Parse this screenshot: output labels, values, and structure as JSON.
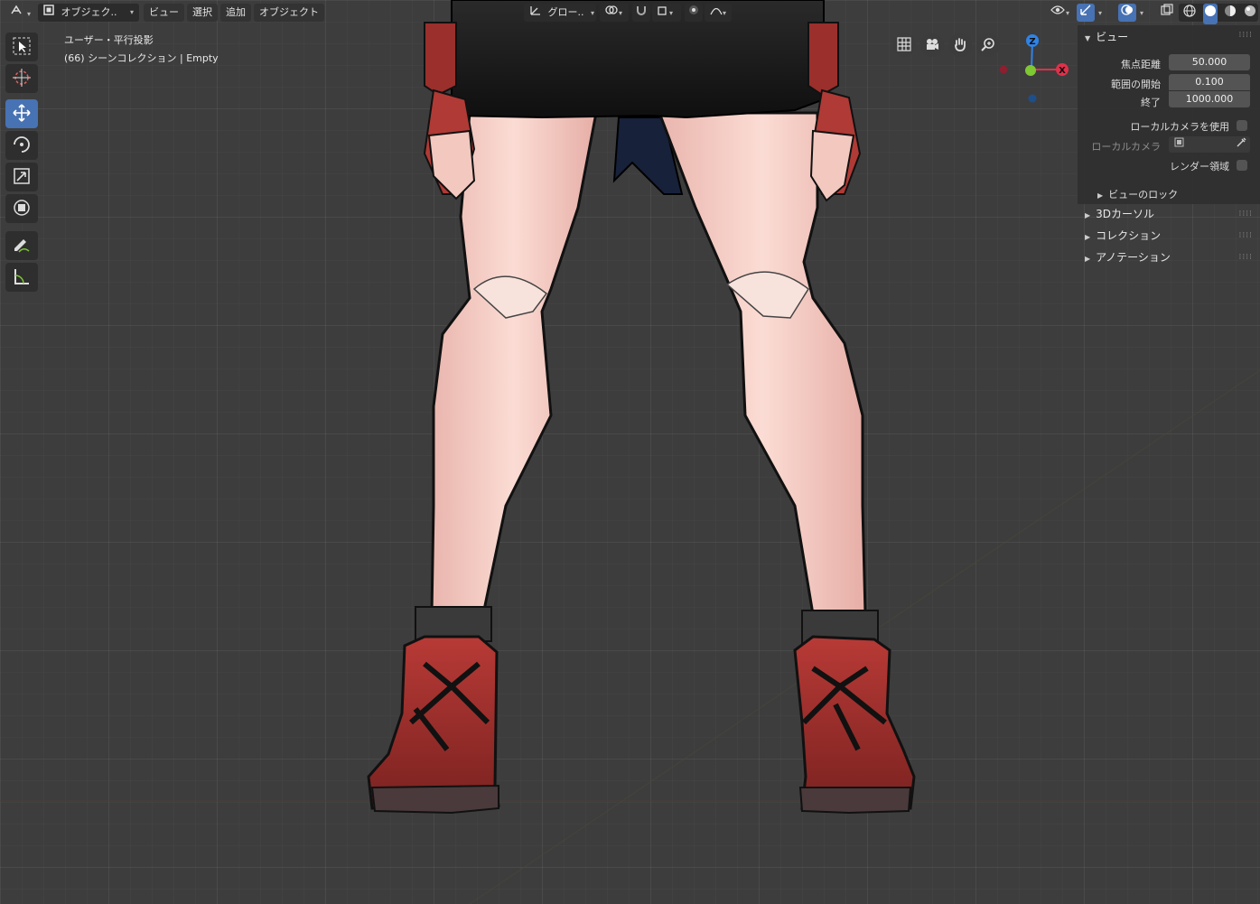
{
  "header": {
    "editor_type_icon": "3d-viewport-icon",
    "mode_label": "オブジェク..",
    "menus": [
      "ビュー",
      "選択",
      "追加",
      "オブジェクト"
    ],
    "transform_orientation": "グロー..",
    "viewport_shading": "solid"
  },
  "toolbar": {
    "tools": [
      {
        "name": "select-box-tool",
        "icon": "cursor-box-icon",
        "active": false
      },
      {
        "name": "cursor-tool",
        "icon": "crosshair-icon",
        "active": false
      },
      {
        "name": "move-tool",
        "icon": "move-arrows-icon",
        "active": true
      },
      {
        "name": "rotate-tool",
        "icon": "rotate-icon",
        "active": false
      },
      {
        "name": "scale-tool",
        "icon": "scale-icon",
        "active": false
      },
      {
        "name": "transform-tool",
        "icon": "transform-icon",
        "active": false
      },
      {
        "name": "annotate-tool",
        "icon": "pencil-icon",
        "active": false
      },
      {
        "name": "measure-tool",
        "icon": "ruler-icon",
        "active": false
      }
    ]
  },
  "overlay": {
    "view_name": "ユーザー・平行投影",
    "collection_info": "(66) シーンコレクション | Empty"
  },
  "gizmo": {
    "axes": {
      "z": "Z",
      "x": "X"
    },
    "colors": {
      "x": "#e0304a",
      "y": "#7ec833",
      "z": "#2f83e6",
      "x_neg": "#8a2030",
      "z_neg": "#1d4f8a"
    }
  },
  "sidebar": {
    "view_panel": {
      "title": "ビュー",
      "focal_length_label": "焦点距離",
      "focal_length": "50.000",
      "clip_start_label": "範囲の開始",
      "clip_start": "0.100",
      "clip_end_label": "終了",
      "clip_end": "1000.000",
      "local_camera_use_label": "ローカルカメラを使用",
      "local_camera_label": "ローカルカメラ",
      "render_region_label": "レンダー領域",
      "view_lock_label": "ビューのロック"
    },
    "subpanels": [
      "3Dカーソル",
      "コレクション",
      "アノテーション"
    ]
  },
  "colors": {
    "accent": "#4772b3",
    "background": "#3d3d3d",
    "skin": "#f0c2b8",
    "boot_red": "#a8322e",
    "skirt": "#151515"
  }
}
